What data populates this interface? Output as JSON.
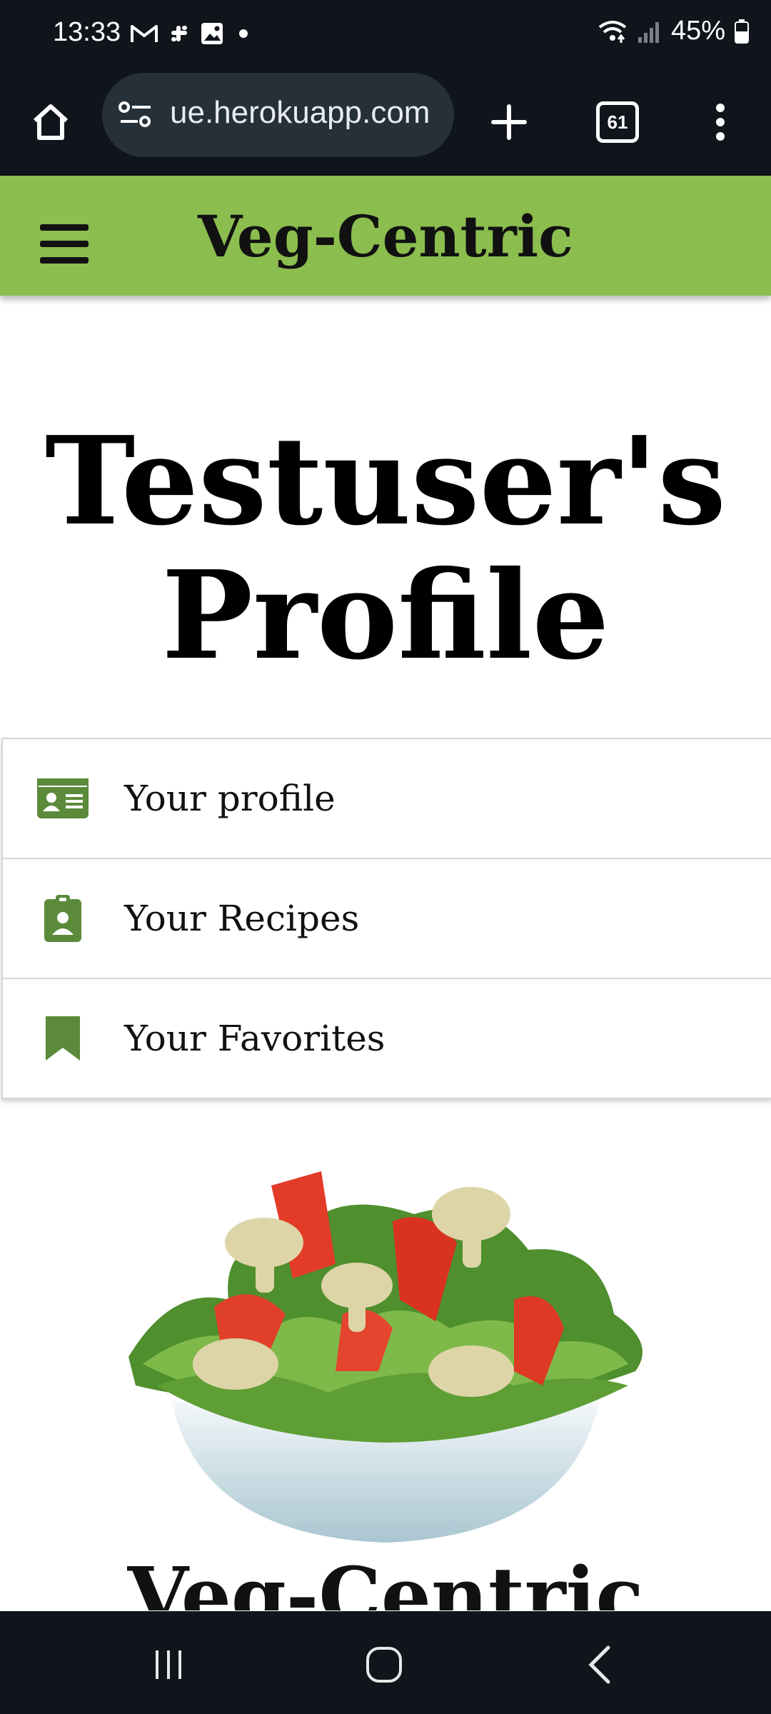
{
  "status_bar": {
    "time": "13:33",
    "battery": "45%",
    "icons_left": [
      "gmail-icon",
      "slack-icon",
      "gallery-icon",
      "dot-icon"
    ],
    "icons_right": [
      "wifi-icon",
      "signal-icon",
      "battery-icon"
    ]
  },
  "browser": {
    "url": "ue.herokuapp.com",
    "tab_count": "61"
  },
  "header": {
    "title": "Veg-Centric",
    "accent_color": "#8bbd4f"
  },
  "page": {
    "title_line1": "Testuser's",
    "title_line2": "Profile"
  },
  "menu": {
    "items": [
      {
        "label": "Your profile",
        "icon": "id-card-icon"
      },
      {
        "label": "Your Recipes",
        "icon": "clipboard-user-icon"
      },
      {
        "label": "Your Favorites",
        "icon": "bookmark-icon"
      }
    ],
    "icon_color": "#5b8a3a"
  },
  "footer_logo": {
    "text": "Veg-Centric"
  }
}
